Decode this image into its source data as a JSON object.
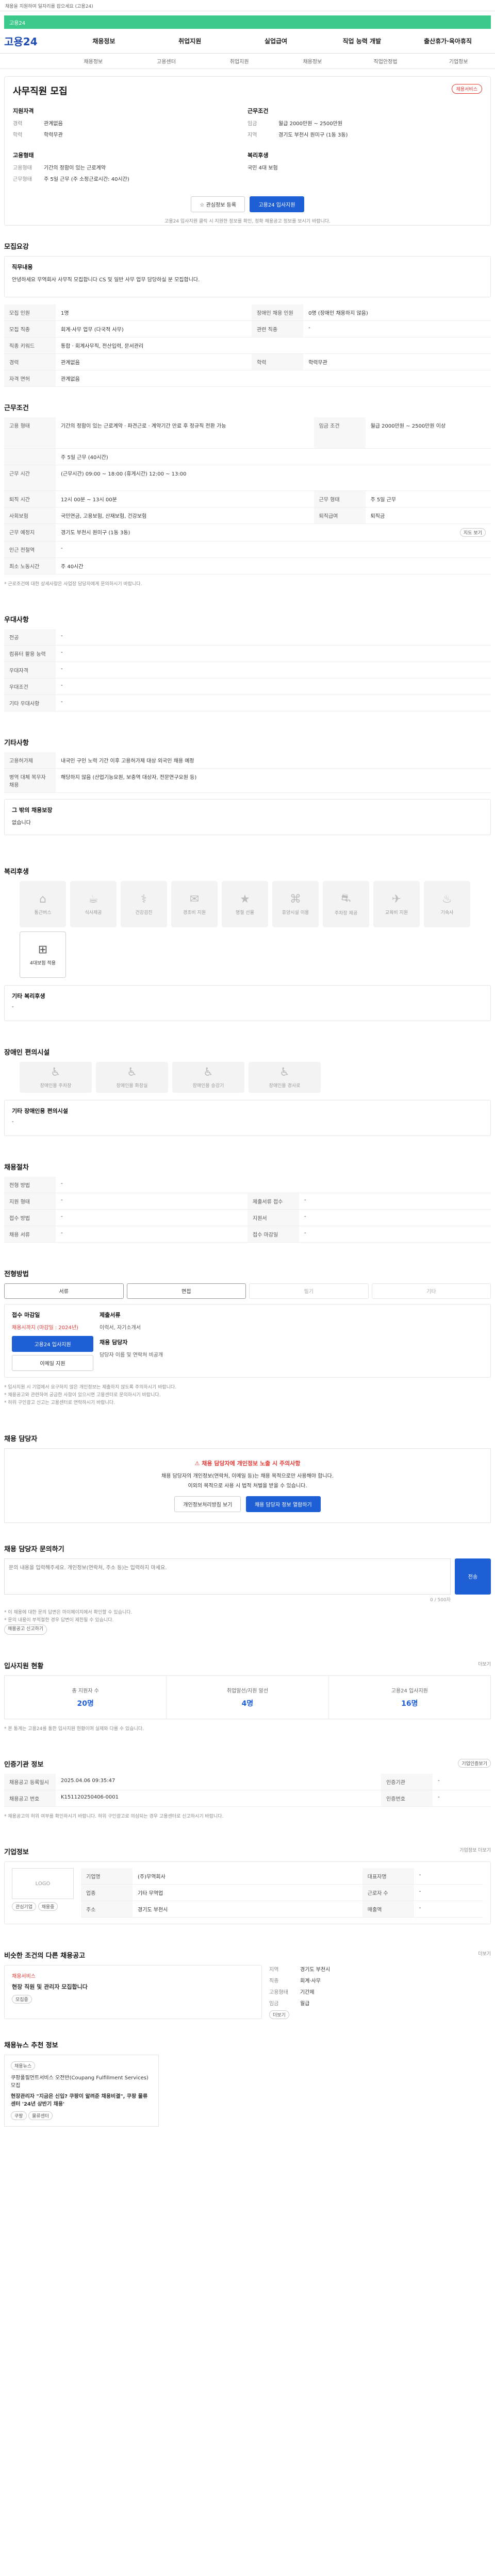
{
  "top": {
    "notice": "채용을 지원하여 일자리를 잡으세요 (고용24)"
  },
  "banner": {
    "text": "고용24"
  },
  "gnb": {
    "logo": "고용24",
    "items": [
      "채용정보",
      "취업지원",
      "실업급여",
      "직업 능력 개발",
      "출산휴가·육아휴직"
    ]
  },
  "subnav": [
    "채용정보",
    "고용센터",
    "취업지원",
    "채용정보",
    "직업안정법",
    "기업정보"
  ],
  "job": {
    "title": "사무직원 모집",
    "recruit_badge": "채용서비스",
    "left_head": "지원자격",
    "left": [
      {
        "k": "경력",
        "v": "관계없음"
      },
      {
        "k": "학력",
        "v": "학력무관"
      }
    ],
    "right_head": "근무조건",
    "right": [
      {
        "k": "임금",
        "v": "월급 2000만원 ~ 2500만원"
      },
      {
        "k": "지역",
        "v": "경기도 부천시 원미구 (1동 3동)"
      }
    ],
    "left2_head": "고용형태",
    "left2": [
      {
        "k": "고용형태",
        "v": "기간의 정함이 있는 근로계약"
      },
      {
        "k": "근무형태",
        "v": "주 5일 근무 (주 소정근로시간: 40시간)"
      }
    ],
    "right2_head": "복리후생",
    "right2": [
      {
        "k": "",
        "v": "국민 4대 보험"
      }
    ],
    "btn_interest": "관심정보 등록",
    "btn_apply": "고용24 입사지원",
    "note": "고용24 입사지원 클릭 시 지원한 정보를 확인, 정확 채용공고 정보를 보시기 바랍니다."
  },
  "duty": {
    "title": "모집요강",
    "head": "직무내용",
    "text": "안녕하세요 무역회사 사무직 모집합니다 CS 및 일반 사무 업무 담당하실 분 모집합니다.",
    "rows": [
      {
        "k": "모집 인원",
        "v": "1명",
        "k2": "장애인 채용 인원",
        "v2": "0명 (장애인 채용하지 않음)"
      },
      {
        "k": "모집 직종",
        "v": "회계·사무 업무 (다국적 사무)",
        "k2": "관련 직종",
        "v2": "-"
      },
      {
        "k": "직종 키워드",
        "v": "통합 · 회계사무직, 전산입력, 문서관리",
        "k2": "",
        "v2": ""
      },
      {
        "k": "경력",
        "v": "관계없음",
        "k2": "학력",
        "v2": "학력무관"
      },
      {
        "k": "자격 면허",
        "v": "관계없음",
        "k2": "",
        "v2": ""
      }
    ]
  },
  "conditions": {
    "title": "근무조건",
    "rows": [
      {
        "k": "고용 형태",
        "v": "기간의 정함이 있는 근로계약 · 파견근로 · 계약기간 만료 후 정규직 전환 가능",
        "k2": "임금 조건",
        "v2": "월급 2000만원 ~ 2500만원 이상"
      },
      {
        "k": "",
        "v": "주 5일 근무 (40시간)",
        "k2": "",
        "v2": ""
      },
      {
        "k": "근무 시간",
        "v": "(근무시간) 09:00 ~ 18:00 (휴게시간) 12:00 ~ 13:00",
        "k2": "",
        "v2": ""
      },
      {
        "k": "퇴직 시간",
        "v": "12시 00분 ~ 13시 00분",
        "k2": "근무 형태",
        "v2": "주 5일 근무"
      },
      {
        "k": "사회보험",
        "v": "국민연금, 고용보험, 산재보험, 건강보험",
        "k2": "퇴직급여",
        "v2": "퇴직금"
      },
      {
        "k": "근무 예정지",
        "v": "경기도 부천시 원미구 (1동 3동)",
        "k2": "",
        "v2": ""
      },
      {
        "k": "인근 전철역",
        "v": "-",
        "k2": "",
        "v2": ""
      },
      {
        "k": "최소 노동시간",
        "v": "주 40시간",
        "k2": "",
        "v2": ""
      }
    ],
    "map_btn": "지도 보기",
    "note": "* 근로조건에 대한 상세사항은 사업장 담당자에게 문의하시기 바랍니다."
  },
  "prefer": {
    "title": "우대사항",
    "rows": [
      {
        "k": "전공",
        "v": "-"
      },
      {
        "k": "컴퓨터 활용 능력",
        "v": "-"
      },
      {
        "k": "우대자격",
        "v": "-"
      },
      {
        "k": "우대조건",
        "v": "-"
      },
      {
        "k": "기타 우대사항",
        "v": "-"
      }
    ]
  },
  "etc": {
    "title": "기타사항",
    "rows": [
      {
        "k": "고용허가제",
        "v": "내국인 구인 노력 기간 이후 고용허가제 대상 외국인 채용 예정"
      },
      {
        "k": "병역 대체 복무자 채용",
        "v": "해당하지 않음 (산업기능요원, 보충역 대상자, 전문연구요원 등)"
      }
    ],
    "extra_head": "그 밖의 채용보장",
    "extra_text": "없습니다"
  },
  "welfare": {
    "title": "복리후생",
    "items": [
      {
        "icon": "⌂",
        "label": "통근버스",
        "on": false
      },
      {
        "icon": "☕",
        "label": "식사제공",
        "on": false
      },
      {
        "icon": "⚕",
        "label": "건강검진",
        "on": false
      },
      {
        "icon": "✉",
        "label": "경조비 지원",
        "on": false
      },
      {
        "icon": "★",
        "label": "명절 선물",
        "on": false
      },
      {
        "icon": "⌘",
        "label": "휴양시설 이용",
        "on": false
      },
      {
        "icon": "⛐",
        "label": "주차장 제공",
        "on": false
      },
      {
        "icon": "✈",
        "label": "교육비 지원",
        "on": false
      },
      {
        "icon": "♨",
        "label": "기숙사",
        "on": false
      },
      {
        "icon": "⊞",
        "label": "4대보험 적용",
        "on": true
      }
    ],
    "extra_head": "기타 복리후생",
    "extra_text": "-"
  },
  "disabled": {
    "title": "장애인 편의시설",
    "items": [
      {
        "icon": "♿",
        "label": "장애인용 주차장"
      },
      {
        "icon": "♿",
        "label": "장애인용 화장실"
      },
      {
        "icon": "♿",
        "label": "장애인용 승강기"
      },
      {
        "icon": "♿",
        "label": "장애인용 경사로"
      }
    ],
    "extra_head": "기타 장애인용 편의시설",
    "extra_text": "-"
  },
  "process": {
    "title": "채용절차",
    "rows": [
      {
        "k": "전형 방법",
        "v": "-",
        "k2": "",
        "v2": ""
      },
      {
        "k": "지원 형태",
        "v": "-",
        "k2": "제출서류 접수",
        "v2": "-"
      },
      {
        "k": "접수 방법",
        "v": "-",
        "k2": "지원서",
        "v2": "-"
      },
      {
        "k": "채용 서류",
        "v": "-",
        "k2": "접수 마감일",
        "v2": "-"
      }
    ]
  },
  "apply": {
    "title": "전형방법",
    "methods": [
      {
        "label": "서류",
        "on": true
      },
      {
        "label": "면접",
        "on": true
      },
      {
        "label": "필기",
        "on": false
      },
      {
        "label": "기타",
        "on": false
      }
    ],
    "deadline_head": "접수 마감일",
    "deadline": "채용시까지 (마감일 : 2024년)",
    "btn_apply": "고용24 입사지원",
    "btn_email": "이메일 지원",
    "docs_head": "제출서류",
    "docs": "이력서, 자기소개서",
    "contact_head": "채용 담당자",
    "contact": "담당자 이름 및 연락처 비공개",
    "notes": [
      "* 입사지원 시 기업에서 요구하지 않은 개인정보는 제출하지 않도록 주의하시기 바랍니다.",
      "* 채용공고와 관련하여 궁금한 사항이 있으시면 고용센터로 문의하시기 바랍니다.",
      "* 허위 구인광고 신고는 고용센터로 연락하시기 바랍니다."
    ]
  },
  "contact": {
    "title": "채용 담당자",
    "alert": "채용 담당자에 개인정보 노출 시 주의사항",
    "text1": "채용 담당자의 개인정보(연락처, 이메일 등)는 채용 목적으로만 사용해야 합니다.",
    "text2": "이외의 목적으로 사용 시 법적 처벌을 받을 수 있습니다.",
    "btn1": "개인정보처리방침 보기",
    "btn2": "채용 담당자 정보 열람하기"
  },
  "inquiry": {
    "title": "채용 담당자 문의하기",
    "placeholder": "문의 내용을 입력해주세요. 개인정보(연락처, 주소 등)는 입력하지 마세요.",
    "counter": "0 / 500자",
    "btn": "전송",
    "notes": [
      "* 이 채용에 대한 문의 답변은 마이페이지에서 확인할 수 있습니다.",
      "* 문의 내용이 부적절한 경우 답변이 제한될 수 있습니다."
    ],
    "report_btn": "채용공고 신고하기"
  },
  "stats": {
    "title": "입사지원 현황",
    "more": "더보기",
    "items": [
      {
        "label": "총 지원자 수",
        "value": "20명"
      },
      {
        "label": "취업알선/지원 알선",
        "value": "4명"
      },
      {
        "label": "고용24 입사지원",
        "value": "16명"
      }
    ],
    "note": "* 본 통계는 고용24를 통한 입사지원 현황이며 실제와 다를 수 있습니다."
  },
  "cert": {
    "title": "인증기관 정보",
    "btn": "기업인증보기",
    "rows": [
      {
        "k": "채용공고 등록일시",
        "v": "2025.04.06 09:35:47",
        "k2": "인증기관",
        "v2": "-"
      },
      {
        "k": "채용공고 번호",
        "v": "K151120250406-0001",
        "k2": "인증번호",
        "v2": "-"
      }
    ],
    "note": "* 채용공고의 허위 여부를 확인하시기 바랍니다. 허위 구인광고로 의심되는 경우 고용센터로 신고하시기 바랍니다."
  },
  "company": {
    "title": "기업정보",
    "more": "기업정보 더보기",
    "logo": "LOGO",
    "btn_interest": "관심기업",
    "btn_more": "채용중",
    "rows": [
      {
        "k": "기업명",
        "v": "(주)무역회사",
        "k2": "대표자명",
        "v2": "-"
      },
      {
        "k": "업종",
        "v": "기타 무역업",
        "k2": "근로자 수",
        "v2": "-"
      },
      {
        "k": "주소",
        "v": "경기도 부천시",
        "k2": "매출액",
        "v2": "-"
      }
    ]
  },
  "similar": {
    "title": "비슷한 조건의 다른 채용공고",
    "more": "더보기",
    "card_title": "채용서비스",
    "card_text": "현장 직원 및 관리자 모집합니다",
    "card_btn": "모집중",
    "filters": [
      {
        "k": "지역",
        "v": "경기도 부천시"
      },
      {
        "k": "직종",
        "v": "회계·사무"
      },
      {
        "k": "고용형태",
        "v": "기간제"
      },
      {
        "k": "임금",
        "v": "월급"
      }
    ],
    "btn_more": "더보기"
  },
  "news": {
    "title": "채용뉴스 추천 정보",
    "badge": "채용뉴스",
    "headline": "쿠팡풀필먼트서비스 오전반(Coupang Fulfillment Services) 모집",
    "text": "현장관리자 \"지금은 신입? 쿠팡이 알려준 채용비결\", 쿠팡 물류센터 '24년 상반기 채용'",
    "tag1": "쿠팡",
    "tag2": "물류센터"
  }
}
